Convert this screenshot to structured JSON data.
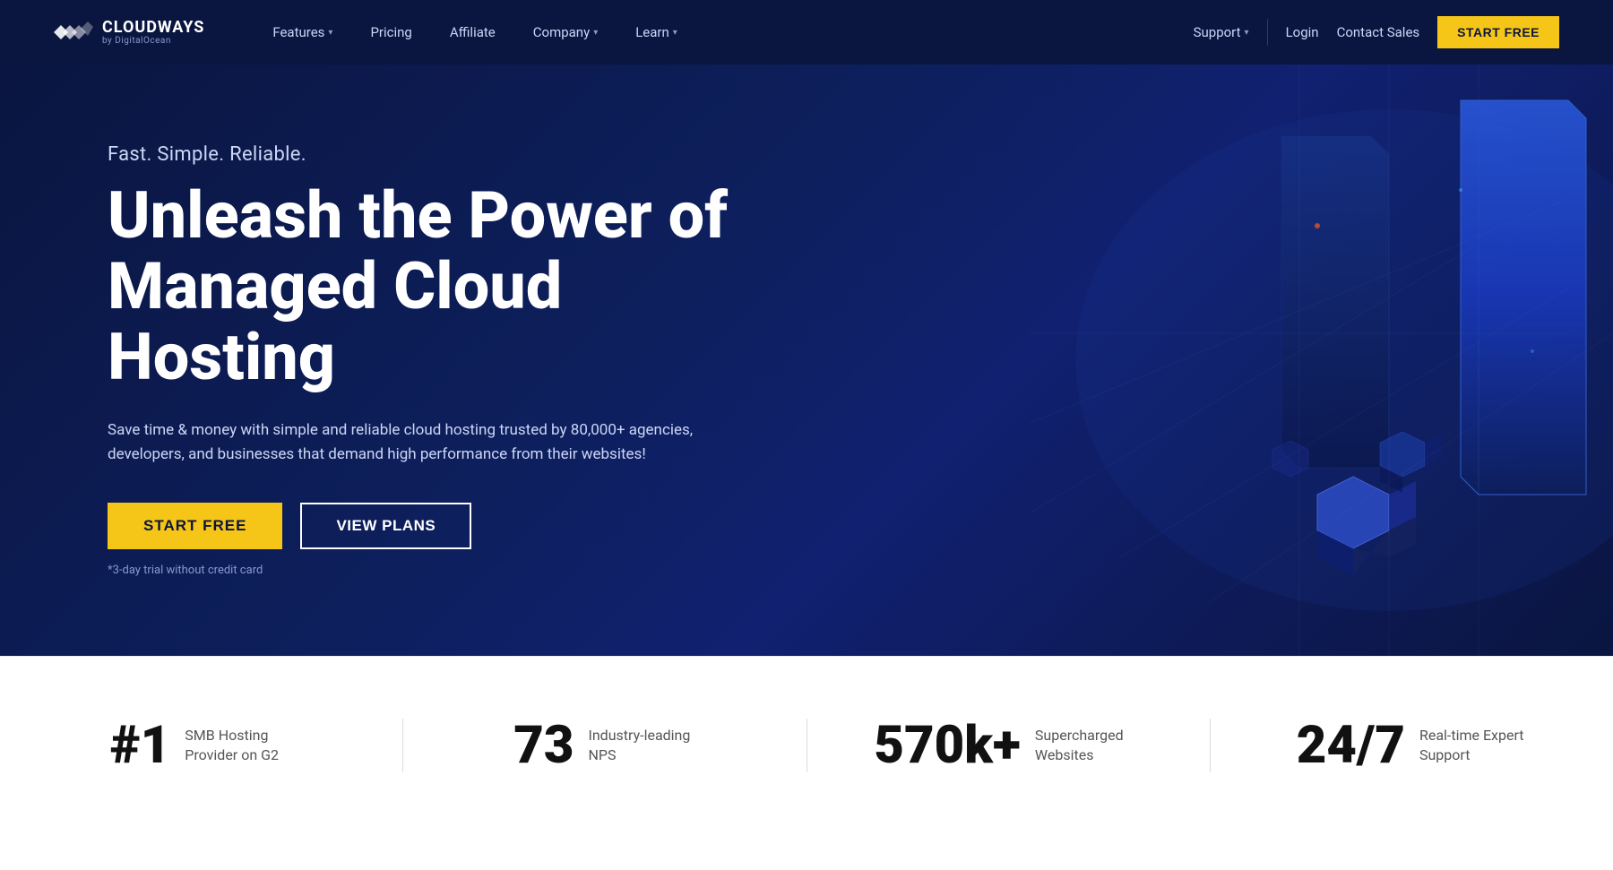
{
  "brand": {
    "name": "CLOUDWAYS",
    "sub": "by DigitalOcean"
  },
  "nav": {
    "features_label": "Features",
    "pricing_label": "Pricing",
    "affiliate_label": "Affiliate",
    "company_label": "Company",
    "learn_label": "Learn",
    "support_label": "Support",
    "login_label": "Login",
    "contact_label": "Contact Sales",
    "start_free_label": "START FREE"
  },
  "hero": {
    "tagline": "Fast. Simple. Reliable.",
    "title_line1": "Unleash the Power of",
    "title_line2": "Managed Cloud Hosting",
    "description": "Save time & money with simple and reliable cloud hosting trusted by 80,000+ agencies, developers, and businesses that demand high performance from their websites!",
    "btn_start": "START FREE",
    "btn_plans": "VIEW PLANS",
    "note": "*3-day trial without credit card"
  },
  "stats": [
    {
      "number": "#1",
      "text": "SMB Hosting Provider on G2"
    },
    {
      "number": "73",
      "text": "Industry-leading NPS"
    },
    {
      "number": "570k+",
      "text": "Supercharged Websites"
    },
    {
      "number": "24/7",
      "text": "Real-time Expert Support"
    }
  ]
}
